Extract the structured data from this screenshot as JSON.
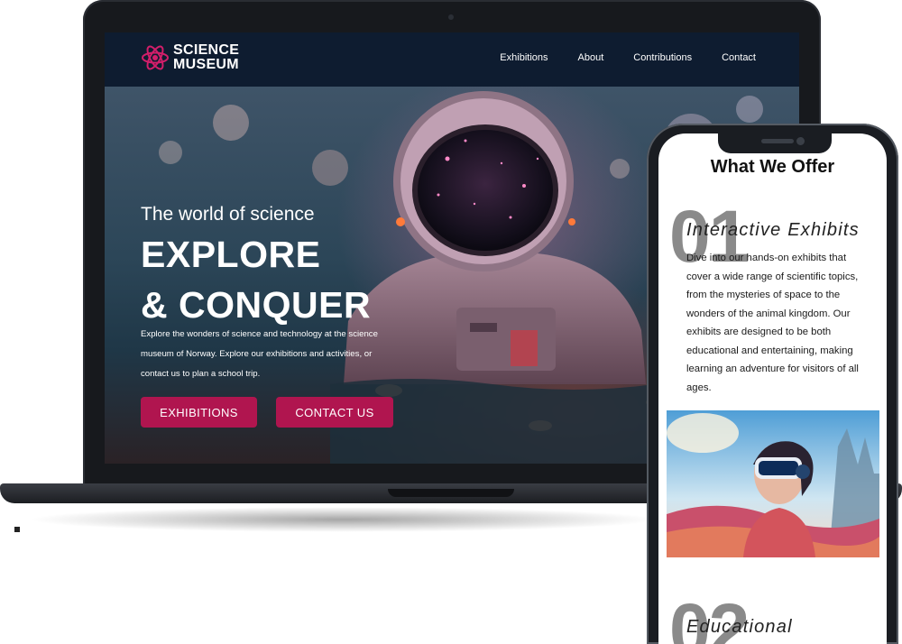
{
  "site": {
    "logo": {
      "line1": "SCIENCE",
      "line2": "MUSEUM"
    },
    "nav": [
      "Exhibitions",
      "About",
      "Contributions",
      "Contact"
    ]
  },
  "hero": {
    "subtitle": "The world of science",
    "title_line1": "EXPLORE",
    "title_line2": "& CONQUER",
    "description": "Explore the wonders of science and technology at the science museum  of Norway. Explore our exhibitions and activities, or contact us to plan  a school trip.",
    "buttons": {
      "exhibitions": "EXHIBITIONS",
      "contact": "CONTACT US"
    }
  },
  "mobile": {
    "section_title": "What We Offer",
    "items": [
      {
        "number": "01",
        "heading": "Interactive Exhibits",
        "description": "Dive into our hands-on exhibits that cover a wide range of scientific topics, from the mysteries of space to the wonders of the animal kingdom. Our exhibits are designed to be both educational and entertaining, making learning an adventure for visitors of all ages."
      },
      {
        "number": "02",
        "heading": "Educational"
      }
    ]
  },
  "colors": {
    "brand_magenta": "#b0154f",
    "nav_bg": "#0e1c30",
    "logo_pink": "#d21e6a"
  }
}
